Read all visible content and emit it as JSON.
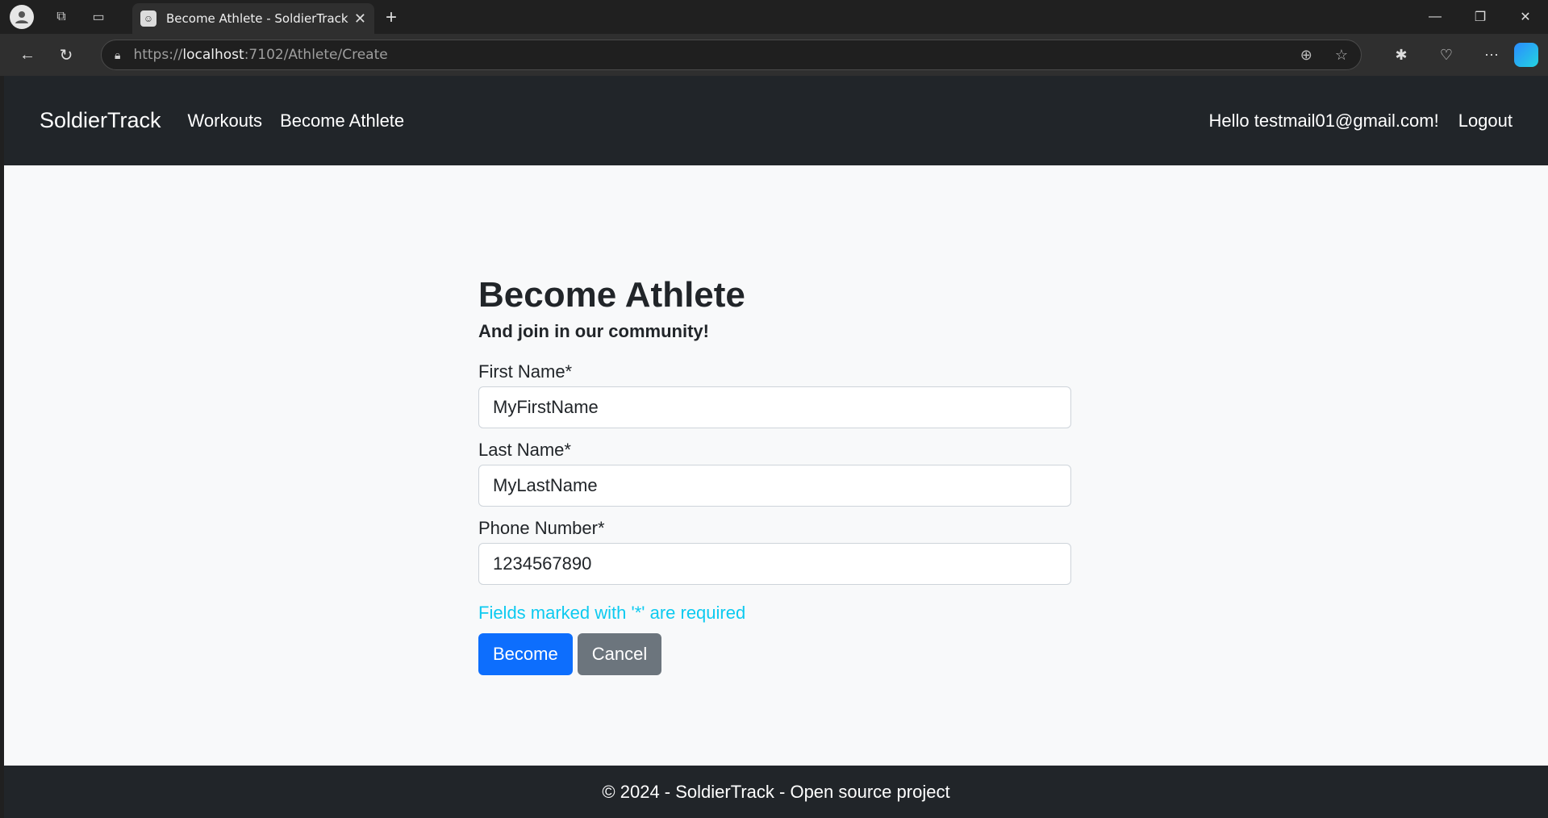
{
  "browser": {
    "tab_title": "Become Athlete - SoldierTrack",
    "url_scheme": "https://",
    "url_host": "localhost",
    "url_rest": ":7102/Athlete/Create"
  },
  "navbar": {
    "brand": "SoldierTrack",
    "links": [
      "Workouts",
      "Become Athlete"
    ],
    "greeting": "Hello testmail01@gmail.com!",
    "logout": "Logout"
  },
  "form": {
    "title": "Become Athlete",
    "subtitle": "And join in our community!",
    "first_name_label": "First Name*",
    "first_name_value": "MyFirstName",
    "last_name_label": "Last Name*",
    "last_name_value": "MyLastName",
    "phone_label": "Phone Number*",
    "phone_value": "1234567890",
    "hint": "Fields marked with '*' are required",
    "submit_label": "Become",
    "cancel_label": "Cancel"
  },
  "footer": {
    "text": "© 2024 - SoldierTrack - Open source project"
  },
  "colors": {
    "primary": "#0d6efd",
    "secondary": "#6c757d",
    "info": "#0dcaf0",
    "dark": "#212529"
  }
}
